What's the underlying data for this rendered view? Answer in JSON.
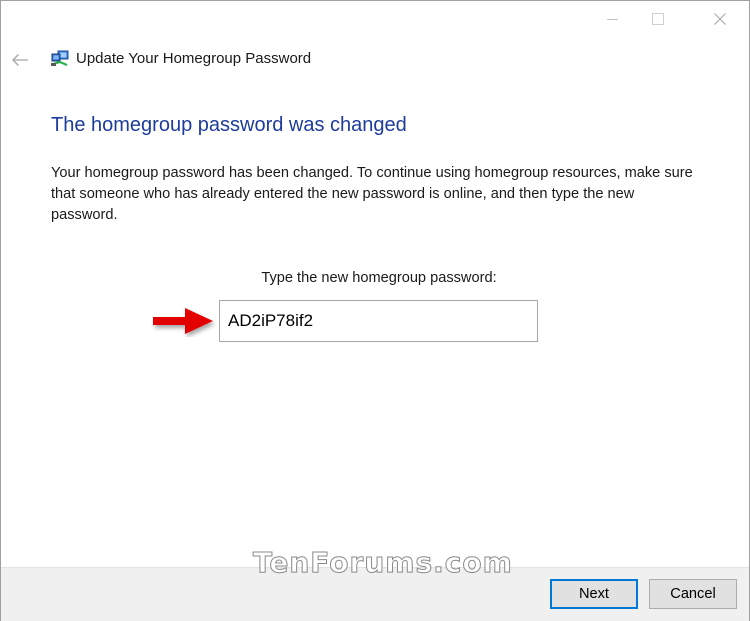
{
  "window": {
    "title": "Update Your Homegroup Password",
    "controls": {
      "minimize": "minimize-icon",
      "maximize": "maximize-icon",
      "close": "close-icon"
    },
    "back_icon": "back-arrow-icon",
    "app_icon": "homegroup-network-icon"
  },
  "content": {
    "heading": "The homegroup password was changed",
    "description": "Your homegroup password has been changed. To continue using homegroup resources, make sure that someone who has already entered the new password is online, and then type the new password.",
    "password_label": "Type the new homegroup password:",
    "password_value": "AD2iP78if2",
    "annotation_icon": "red-arrow-icon"
  },
  "watermark": "TenForums.com",
  "footer": {
    "next_label": "Next",
    "cancel_label": "Cancel"
  },
  "colors": {
    "heading": "#1e3c9c",
    "focus_border": "#0078d7",
    "annotation_arrow": "#e30000",
    "footer_bg": "#f0f0f0"
  }
}
